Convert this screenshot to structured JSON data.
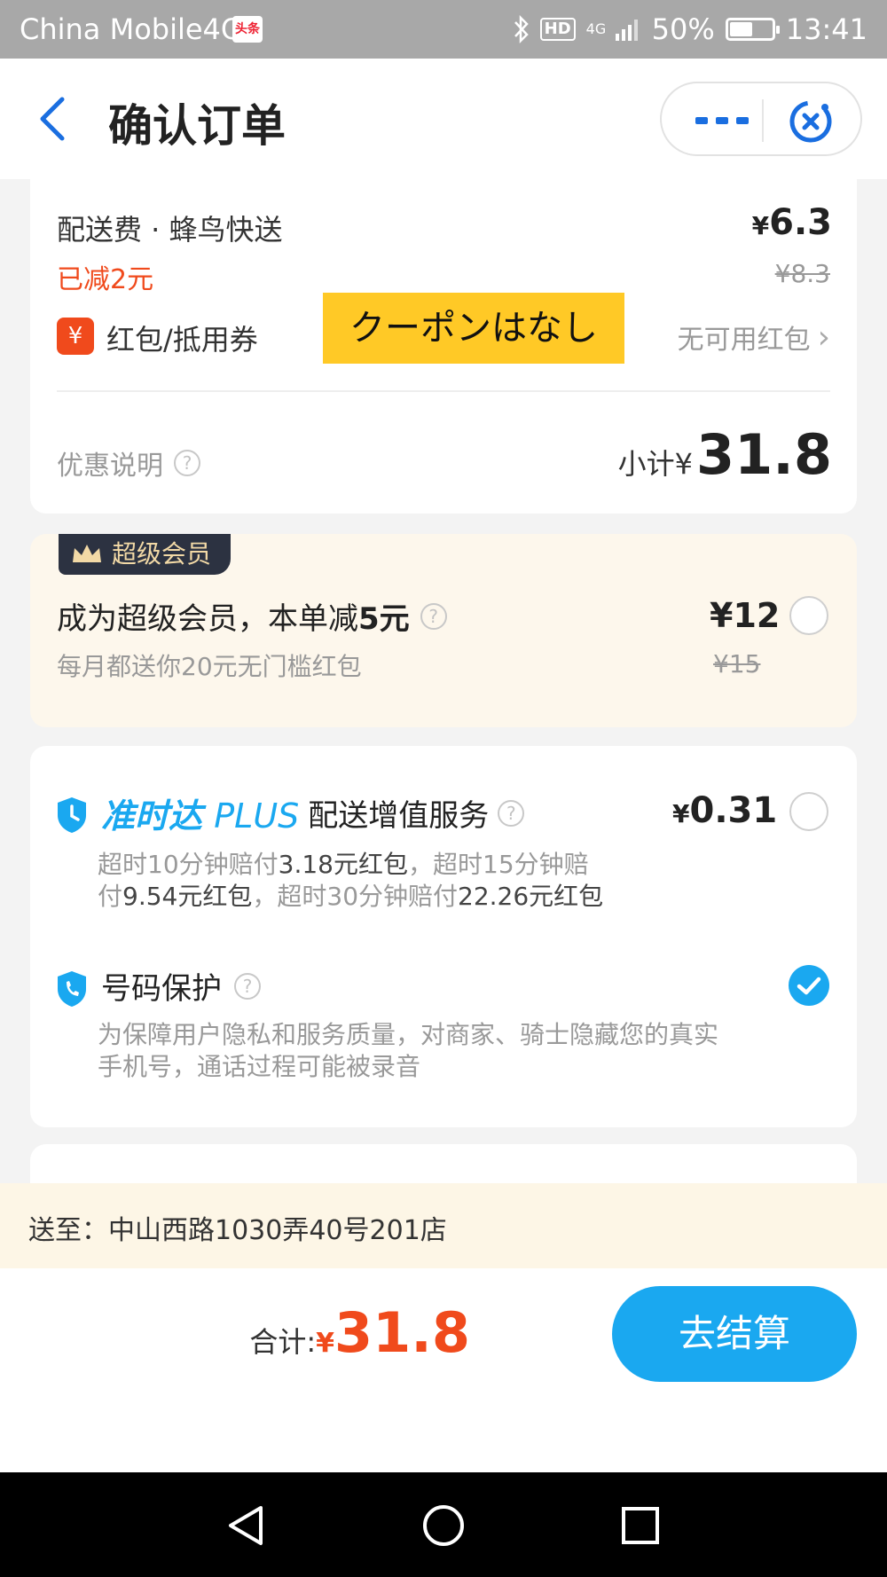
{
  "status_bar": {
    "carrier": "China Mobile4G",
    "news_badge": "头条",
    "bluetooth_icon": "bluetooth-icon",
    "hd": "HD",
    "network": "4G",
    "battery": "50%",
    "battery_level": 0.5,
    "time": "13:41"
  },
  "header": {
    "title": "确认订单",
    "back_icon": "chevron-left-icon",
    "more_icon": "more-icon",
    "close_icon": "close-target-icon"
  },
  "delivery": {
    "label": "配送费 · 蜂鸟快送",
    "price_symbol": "¥",
    "price": "6.3",
    "discount_text": "已减2元",
    "original_price": "¥8.3"
  },
  "coupon": {
    "icon_symbol": "¥",
    "label": "红包/抵用券",
    "value": "无可用红包",
    "chevron": "›",
    "overlay_note": "クーポンはなし"
  },
  "subtotal": {
    "promo_label": "优惠说明",
    "qmark": "?",
    "label": "小计",
    "symbol": "¥",
    "amount": "31.8"
  },
  "membership": {
    "tag": "超级会员",
    "title_part1": "成为超级会员，本单减",
    "title_bold": "5元",
    "subtitle": "每月都送你20元无门槛红包",
    "price": "¥12",
    "original_price": "¥15",
    "selected": false
  },
  "ontime": {
    "brand": "准时达",
    "brand_suffix": "PLUS",
    "title": "配送增值服务",
    "price_symbol": "¥",
    "price": "0.31",
    "desc_line1_a": "超时10分钟赔付",
    "desc_line1_b": "3.18元红包",
    "desc_line1_c": "，超时15分钟赔",
    "desc_line2_a": "付",
    "desc_line2_b": "9.54元红包",
    "desc_line2_c": "，超时30分钟赔付",
    "desc_line2_d": "22.26元红包",
    "selected": false
  },
  "number_protect": {
    "title": "号码保护",
    "desc_line1": "为保障用户隐私和服务质量，对商家、骑士隐藏您的真实",
    "desc_line2": "手机号，通话过程可能被录音",
    "selected": true
  },
  "address": {
    "label": "送至：",
    "value": "中山西路1030弄40号201店"
  },
  "footer": {
    "total_label": "合计:",
    "total_symbol": "¥",
    "total_amount": "31.8",
    "pay_button": "去结算"
  },
  "colors": {
    "accent_blue": "#1aa8f0",
    "price_red": "#f04a1c",
    "note_yellow": "#ffc926"
  }
}
